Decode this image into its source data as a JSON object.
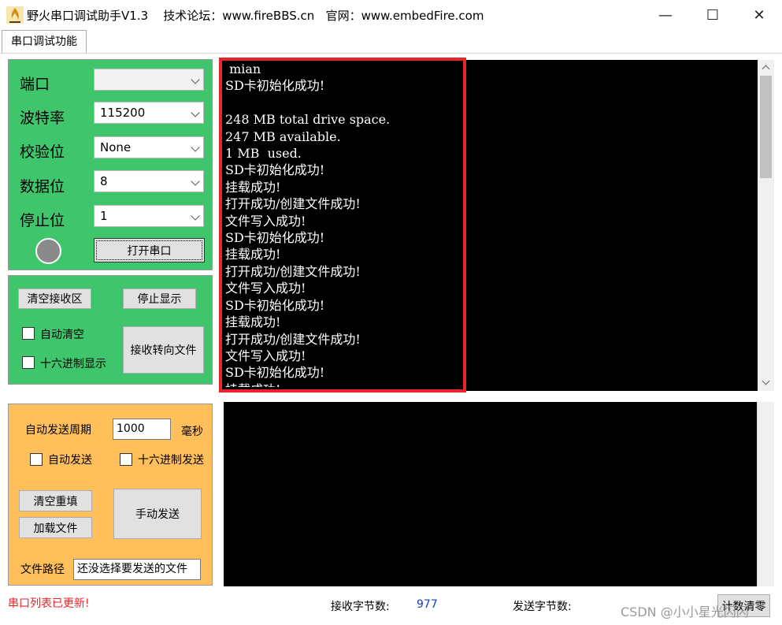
{
  "window": {
    "title": "野火串口调试助手V1.3    技术论坛：www.fireBBS.cn   官网：www.embedFire.com",
    "minimize_glyph": "—",
    "maximize_glyph": "☐",
    "close_glyph": "✕"
  },
  "tab": {
    "label": "串口调试功能"
  },
  "serial_config": {
    "port_label": "端口",
    "port_value": "",
    "baud_label": "波特率",
    "baud_value": "115200",
    "parity_label": "校验位",
    "parity_value": "None",
    "databits_label": "数据位",
    "databits_value": "8",
    "stopbits_label": "停止位",
    "stopbits_value": "1",
    "open_button": "打开串口"
  },
  "receive_controls": {
    "clear_button": "清空接收区",
    "stop_button": "停止显示",
    "auto_clear_label": "自动清空",
    "hex_display_label": "十六进制显示",
    "redirect_button": "接收转向文件"
  },
  "send_controls": {
    "period_label": "自动发送周期",
    "period_value": "1000",
    "period_unit": "毫秒",
    "auto_send_label": "自动发送",
    "hex_send_label": "十六进制发送",
    "clear_refill_button": "清空重填",
    "load_file_button": "加载文件",
    "manual_send_button": "手动发送",
    "file_path_label": "文件路径",
    "file_path_value": "还没选择要发送的文件"
  },
  "receive_area": {
    "text": " mian\nSD卡初始化成功!\n\n248 MB total drive space.\n247 MB available.\n1 MB  used.\nSD卡初始化成功!\n挂载成功!\n打开成功/创建文件成功!\n文件写入成功!\nSD卡初始化成功!\n挂载成功!\n打开成功/创建文件成功!\n文件写入成功!\nSD卡初始化成功!\n挂载成功!\n打开成功/创建文件成功!\n文件写入成功!\nSD卡初始化成功!\n挂载成功!"
  },
  "status": {
    "message": "串口列表已更新!",
    "recv_bytes_label": "接收字节数:",
    "recv_bytes_value": "977",
    "send_bytes_label": "发送字节数:",
    "reset_button": "计数清零",
    "watermark": "CSDN @小小星光闪闪"
  },
  "colors": {
    "serial_panel": "#3fc56b",
    "send_panel": "#ffbf5a",
    "highlight_box": "#e8252b",
    "status_message": "#e8252b",
    "byte_count": "#1a3cc8"
  }
}
